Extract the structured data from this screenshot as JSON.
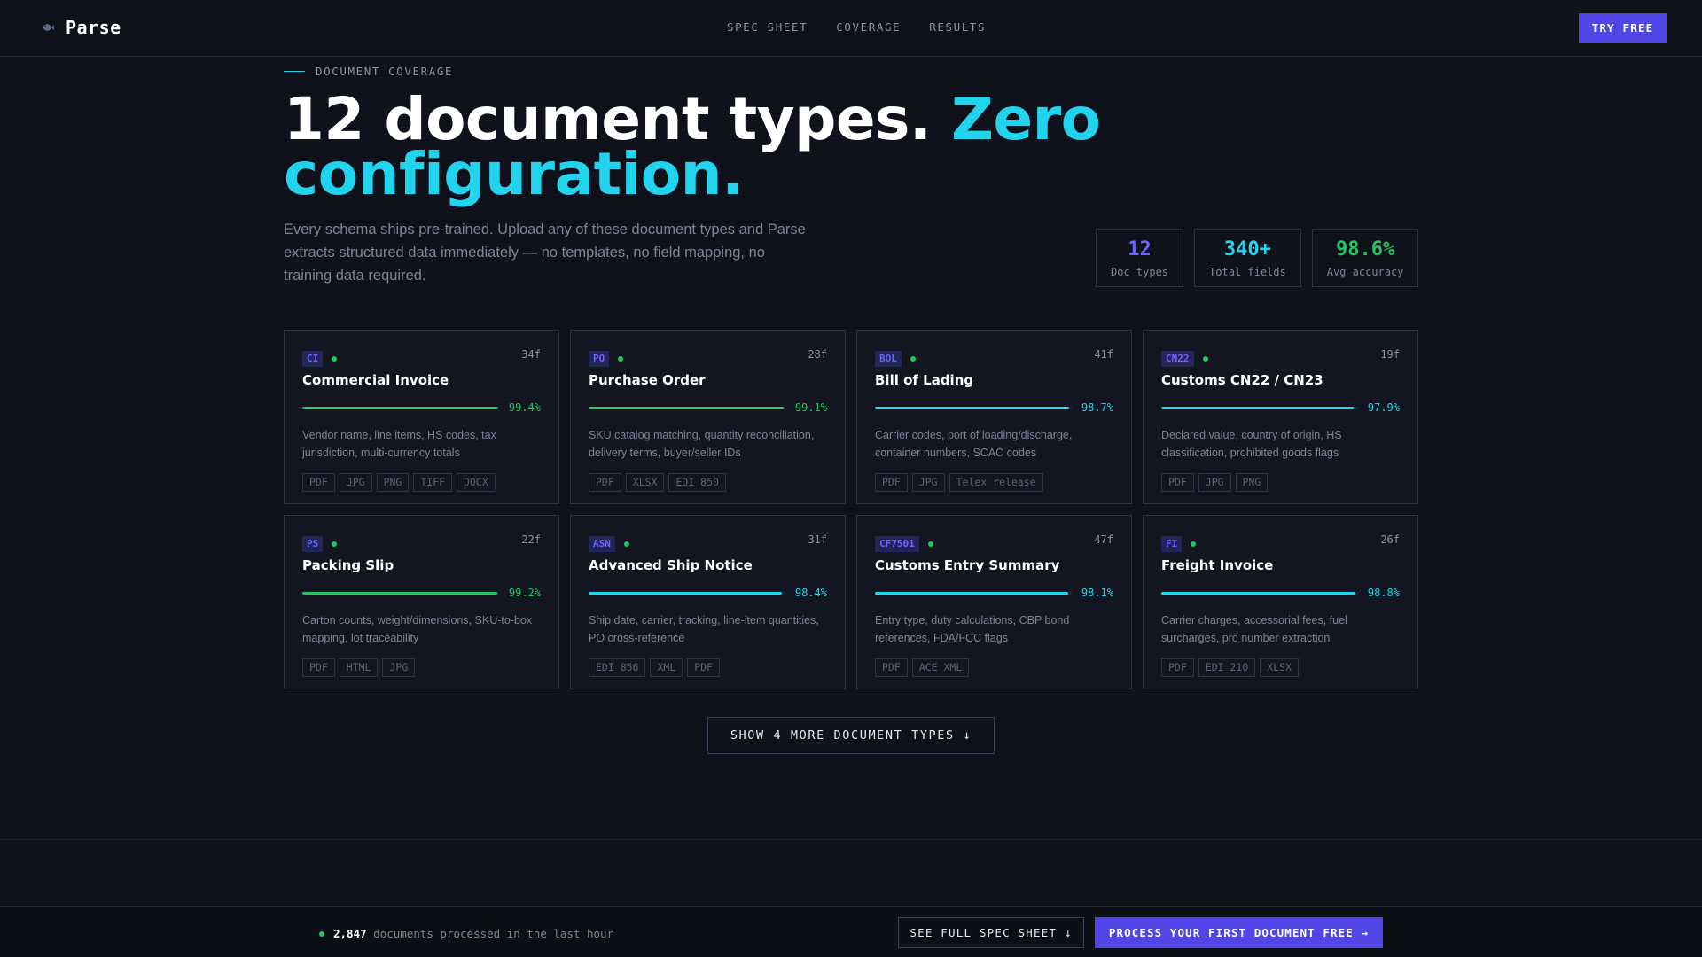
{
  "nav": {
    "brand": "Parse",
    "brand_icon": "fish-icon",
    "links": [
      "SPEC SHEET",
      "COVERAGE",
      "RESULTS"
    ],
    "cta": "TRY FREE"
  },
  "hero": {
    "eyebrow": "DOCUMENT COVERAGE",
    "headline_main": "12 document types.",
    "headline_accent": "Zero configuration.",
    "subtext": "Every schema ships pre-trained. Upload any of these document types and Parse extracts structured data immediately — no templates, no field mapping, no training data required."
  },
  "stats": [
    {
      "value": "12",
      "label": "Doc types",
      "color": "#6c63ff"
    },
    {
      "value": "340+",
      "label": "Total fields",
      "color": "#22d3ee"
    },
    {
      "value": "98.6%",
      "label": "Avg accuracy",
      "color": "#22c55e"
    }
  ],
  "colors": {
    "accent": "#22d3ee",
    "brand": "#4f46e5",
    "success": "#22c55e",
    "badge": "#6c63ff"
  },
  "cards": [
    {
      "code": "CI",
      "fields": "34f",
      "title": "Commercial Invoice",
      "accuracy": "99.4%",
      "accuracy_value": 99.4,
      "bar_color": "#22c55e",
      "desc": "Vendor name, line items, HS codes, tax jurisdiction, multi-currency totals",
      "formats": [
        "PDF",
        "JPG",
        "PNG",
        "TIFF",
        "DOCX"
      ]
    },
    {
      "code": "PO",
      "fields": "28f",
      "title": "Purchase Order",
      "accuracy": "99.1%",
      "accuracy_value": 99.1,
      "bar_color": "#22c55e",
      "desc": "SKU catalog matching, quantity reconciliation, delivery terms, buyer/seller IDs",
      "formats": [
        "PDF",
        "XLSX",
        "EDI 850"
      ]
    },
    {
      "code": "BOL",
      "fields": "41f",
      "title": "Bill of Lading",
      "accuracy": "98.7%",
      "accuracy_value": 98.7,
      "bar_color": "#22d3ee",
      "desc": "Carrier codes, port of loading/discharge, container numbers, SCAC codes",
      "formats": [
        "PDF",
        "JPG",
        "Telex release"
      ]
    },
    {
      "code": "CN22",
      "fields": "19f",
      "title": "Customs CN22 / CN23",
      "accuracy": "97.9%",
      "accuracy_value": 97.9,
      "bar_color": "#22d3ee",
      "desc": "Declared value, country of origin, HS classification, prohibited goods flags",
      "formats": [
        "PDF",
        "JPG",
        "PNG"
      ]
    },
    {
      "code": "PS",
      "fields": "22f",
      "title": "Packing Slip",
      "accuracy": "99.2%",
      "accuracy_value": 99.2,
      "bar_color": "#22c55e",
      "desc": "Carton counts, weight/dimensions, SKU-to-box mapping, lot traceability",
      "formats": [
        "PDF",
        "HTML",
        "JPG"
      ]
    },
    {
      "code": "ASN",
      "fields": "31f",
      "title": "Advanced Ship Notice",
      "accuracy": "98.4%",
      "accuracy_value": 98.4,
      "bar_color": "#22d3ee",
      "desc": "Ship date, carrier, tracking, line-item quantities, PO cross-reference",
      "formats": [
        "EDI 856",
        "XML",
        "PDF"
      ]
    },
    {
      "code": "CF7501",
      "fields": "47f",
      "title": "Customs Entry Summary",
      "accuracy": "98.1%",
      "accuracy_value": 98.1,
      "bar_color": "#22d3ee",
      "desc": "Entry type, duty calculations, CBP bond references, FDA/FCC flags",
      "formats": [
        "PDF",
        "ACE XML"
      ]
    },
    {
      "code": "FI",
      "fields": "26f",
      "title": "Freight Invoice",
      "accuracy": "98.8%",
      "accuracy_value": 98.8,
      "bar_color": "#22d3ee",
      "desc": "Carrier charges, accessorial fees, fuel surcharges, pro number extraction",
      "formats": [
        "PDF",
        "EDI 210",
        "XLSX"
      ]
    }
  ],
  "show_more": "SHOW 4 MORE DOCUMENT TYPES ↓",
  "footer": {
    "count": "2,847",
    "status_text": "documents processed in the last hour",
    "spec_button": "SEE FULL SPEC SHEET ↓",
    "process_button": "PROCESS YOUR FIRST DOCUMENT FREE →"
  }
}
